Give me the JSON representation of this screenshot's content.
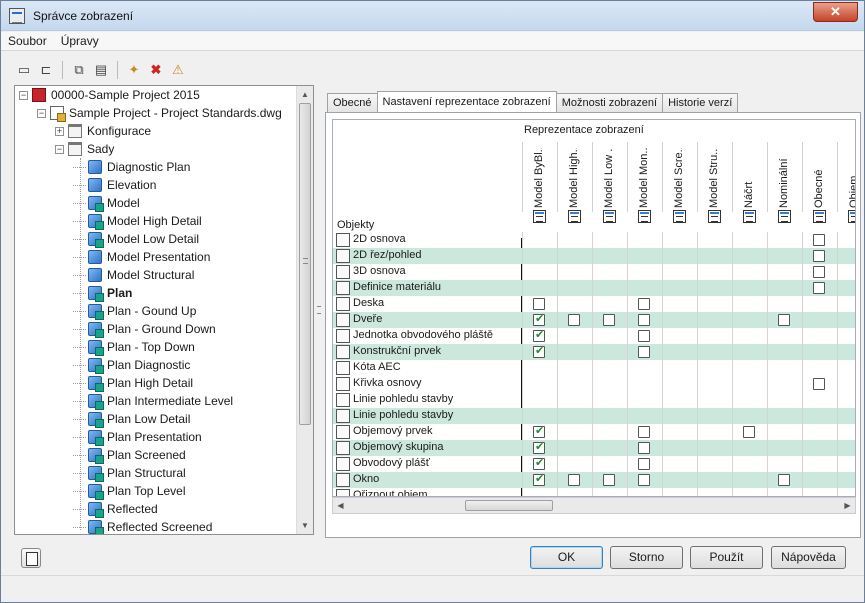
{
  "window": {
    "title": "Správce zobrazení"
  },
  "menu": [
    "Soubor",
    "Úpravy"
  ],
  "toolbar": {
    "icons": [
      "new-icon",
      "open-icon",
      "copy-icon",
      "paste-icon",
      "new-set-icon",
      "delete-icon",
      "purge-icon"
    ]
  },
  "tree": {
    "items": [
      {
        "label": "00000-Sample Project 2015",
        "depth": 0,
        "icon": "rvt",
        "expander": "-"
      },
      {
        "label": "Sample Project - Project Standards.dwg",
        "depth": 1,
        "icon": "dwg",
        "expander": "-"
      },
      {
        "label": "Konfigurace",
        "depth": 2,
        "icon": "folder",
        "expander": "+"
      },
      {
        "label": "Sady",
        "depth": 2,
        "icon": "folder",
        "expander": "-"
      },
      {
        "label": "Diagnostic Plan",
        "depth": 3,
        "icon": "set"
      },
      {
        "label": "Elevation",
        "depth": 3,
        "icon": "set"
      },
      {
        "label": "Model",
        "depth": 3,
        "icon": "set-on"
      },
      {
        "label": "Model High Detail",
        "depth": 3,
        "icon": "set-on"
      },
      {
        "label": "Model Low Detail",
        "depth": 3,
        "icon": "set-on"
      },
      {
        "label": "Model Presentation",
        "depth": 3,
        "icon": "set"
      },
      {
        "label": "Model Structural",
        "depth": 3,
        "icon": "set"
      },
      {
        "label": "Plan",
        "depth": 3,
        "icon": "set-on",
        "bold": true
      },
      {
        "label": "Plan - Gound Up",
        "depth": 3,
        "icon": "set-on"
      },
      {
        "label": "Plan - Ground Down",
        "depth": 3,
        "icon": "set-on"
      },
      {
        "label": "Plan - Top Down",
        "depth": 3,
        "icon": "set-on"
      },
      {
        "label": "Plan Diagnostic",
        "depth": 3,
        "icon": "set-on"
      },
      {
        "label": "Plan High Detail",
        "depth": 3,
        "icon": "set-on"
      },
      {
        "label": "Plan Intermediate Level",
        "depth": 3,
        "icon": "set-on"
      },
      {
        "label": "Plan Low Detail",
        "depth": 3,
        "icon": "set-on"
      },
      {
        "label": "Plan Presentation",
        "depth": 3,
        "icon": "set-on"
      },
      {
        "label": "Plan Screened",
        "depth": 3,
        "icon": "set-on"
      },
      {
        "label": "Plan Structural",
        "depth": 3,
        "icon": "set-on"
      },
      {
        "label": "Plan Top Level",
        "depth": 3,
        "icon": "set-on"
      },
      {
        "label": "Reflected",
        "depth": 3,
        "icon": "set-on"
      },
      {
        "label": "Reflected Screened",
        "depth": 3,
        "icon": "set-on"
      }
    ]
  },
  "tabs": [
    "Obecné",
    "Nastavení reprezentace zobrazení",
    "Možnosti zobrazení",
    "Historie verzí"
  ],
  "active_tab": 1,
  "grid": {
    "group_label": "Reprezentace zobrazení",
    "objects_label": "Objekty",
    "columns": [
      "Model ByBl...",
      "Model High...",
      "Model Low ...",
      "Model Mon...",
      "Model Scre...",
      "Model Stru...",
      "Náčrt",
      "Nominální",
      "Obecné",
      "Objem"
    ],
    "rows": [
      {
        "label": "2D osnova",
        "alt": false,
        "cells": [
          null,
          null,
          null,
          null,
          null,
          null,
          null,
          null,
          false,
          null
        ]
      },
      {
        "label": "2D řez/pohled",
        "alt": true,
        "cells": [
          null,
          null,
          null,
          null,
          null,
          null,
          null,
          null,
          false,
          null
        ]
      },
      {
        "label": "3D osnova",
        "alt": false,
        "cells": [
          null,
          null,
          null,
          null,
          null,
          null,
          null,
          null,
          false,
          null
        ]
      },
      {
        "label": "Definice materiálu",
        "alt": true,
        "cells": [
          null,
          null,
          null,
          null,
          null,
          null,
          null,
          null,
          false,
          null
        ]
      },
      {
        "label": "Deska",
        "alt": false,
        "cells": [
          false,
          null,
          null,
          false,
          null,
          null,
          null,
          null,
          null,
          null
        ]
      },
      {
        "label": "Dveře",
        "alt": true,
        "cells": [
          true,
          false,
          false,
          false,
          null,
          null,
          null,
          false,
          null,
          null
        ]
      },
      {
        "label": "Jednotka obvodového pláště",
        "alt": false,
        "cells": [
          true,
          null,
          null,
          false,
          null,
          null,
          null,
          null,
          null,
          null
        ]
      },
      {
        "label": "Konstrukční prvek",
        "alt": true,
        "cells": [
          true,
          null,
          null,
          false,
          null,
          null,
          null,
          null,
          null,
          null
        ]
      },
      {
        "label": "Kóta AEC",
        "alt": false,
        "cells": [
          null,
          null,
          null,
          null,
          null,
          null,
          null,
          null,
          null,
          null
        ]
      },
      {
        "label": "Křivka osnovy",
        "alt": false,
        "cells": [
          null,
          null,
          null,
          null,
          null,
          null,
          null,
          null,
          false,
          null
        ]
      },
      {
        "label": "Linie pohledu stavby",
        "alt": false,
        "cells": [
          null,
          null,
          null,
          null,
          null,
          null,
          null,
          null,
          null,
          null
        ]
      },
      {
        "label": "Linie pohledu stavby",
        "alt": true,
        "cells": [
          null,
          null,
          null,
          null,
          null,
          null,
          null,
          null,
          null,
          null
        ]
      },
      {
        "label": "Objemový prvek",
        "alt": false,
        "cells": [
          true,
          null,
          null,
          false,
          null,
          null,
          false,
          null,
          null,
          null
        ]
      },
      {
        "label": "Objemový skupina",
        "alt": true,
        "cells": [
          true,
          null,
          null,
          false,
          null,
          null,
          null,
          null,
          null,
          null
        ]
      },
      {
        "label": "Obvodový plášť",
        "alt": false,
        "cells": [
          true,
          null,
          null,
          false,
          null,
          null,
          null,
          null,
          null,
          null
        ]
      },
      {
        "label": "Okno",
        "alt": true,
        "cells": [
          true,
          false,
          false,
          false,
          null,
          null,
          null,
          false,
          null,
          null
        ]
      },
      {
        "label": "Ořiznout objem",
        "alt": false,
        "cells": [
          null,
          null,
          null,
          null,
          null,
          null,
          null,
          null,
          null,
          null
        ]
      }
    ]
  },
  "buttons": {
    "ok": "OK",
    "cancel": "Storno",
    "apply": "Použít",
    "help": "Nápověda"
  }
}
